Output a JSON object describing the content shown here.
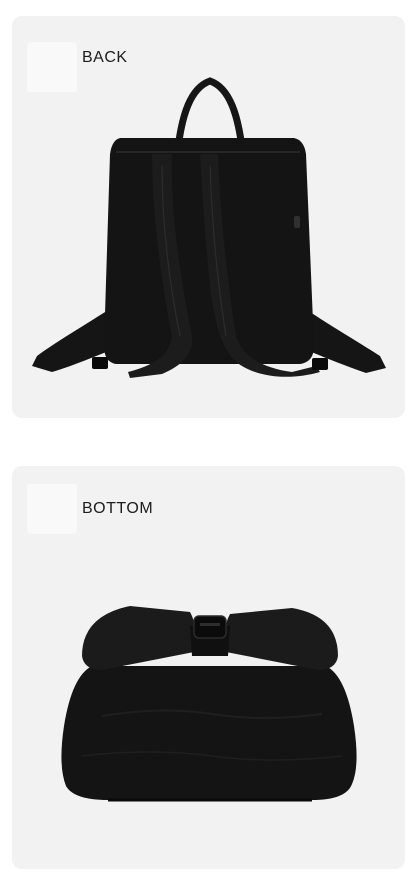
{
  "sections": [
    {
      "label": "BACK"
    },
    {
      "label": "BOTTOM"
    }
  ],
  "colors": {
    "page_background": "#ffffff",
    "panel_background": "#f2f2f2",
    "swatch": "#f9f9f9",
    "bag": "#151515",
    "text": "#1c1c1c"
  }
}
